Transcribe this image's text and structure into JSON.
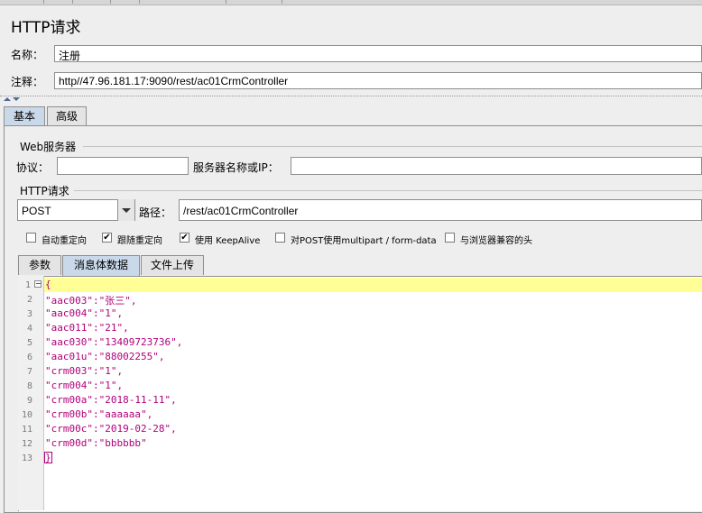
{
  "title": "HTTP请求",
  "name": {
    "label": "名称：",
    "value": "注册"
  },
  "comment": {
    "label": "注释：",
    "value": "http//47.96.181.17:9090/rest/ac01CrmController"
  },
  "main_tabs": [
    "基本",
    "高级"
  ],
  "web_server": {
    "group_label": "Web服务器",
    "protocol_label": "协议：",
    "protocol_value": "",
    "server_label": "服务器名称或IP：",
    "server_value": ""
  },
  "http_request": {
    "group_label": "HTTP请求",
    "method": "POST",
    "path_label": "路径：",
    "path_value": "/rest/ac01CrmController"
  },
  "options": [
    {
      "label": "自动重定向",
      "checked": false
    },
    {
      "label": "跟随重定向",
      "checked": true
    },
    {
      "label": "使用 KeepAlive",
      "checked": true
    },
    {
      "label": "对POST使用multipart / form-data",
      "checked": false
    },
    {
      "label": "与浏览器兼容的头",
      "checked": false
    }
  ],
  "body_tabs": [
    "参数",
    "消息体数据",
    "文件上传"
  ],
  "editor_lines": [
    "{",
    "\"aac003\":\"张三\",",
    "\"aac004\":\"1\",",
    "\"aac011\":\"21\",",
    "\"aac030\":\"13409723736\",",
    "\"aac01u\":\"88002255\",",
    "\"crm003\":\"1\",",
    "\"crm004\":\"1\",",
    "\"crm00a\":\"2018-11-11\",",
    "\"crm00b\":\"aaaaaa\",",
    "\"crm00c\":\"2019-02-28\",",
    "\"crm00d\":\"bbbbbb\"",
    "}"
  ],
  "line_numbers": [
    "1",
    "2",
    "3",
    "4",
    "5",
    "6",
    "7",
    "8",
    "9",
    "10",
    "11",
    "12",
    "13"
  ],
  "colors": {
    "selected_tab": "#c9d9ea",
    "code_text": "#b0007a",
    "current_line": "#ffff96"
  }
}
